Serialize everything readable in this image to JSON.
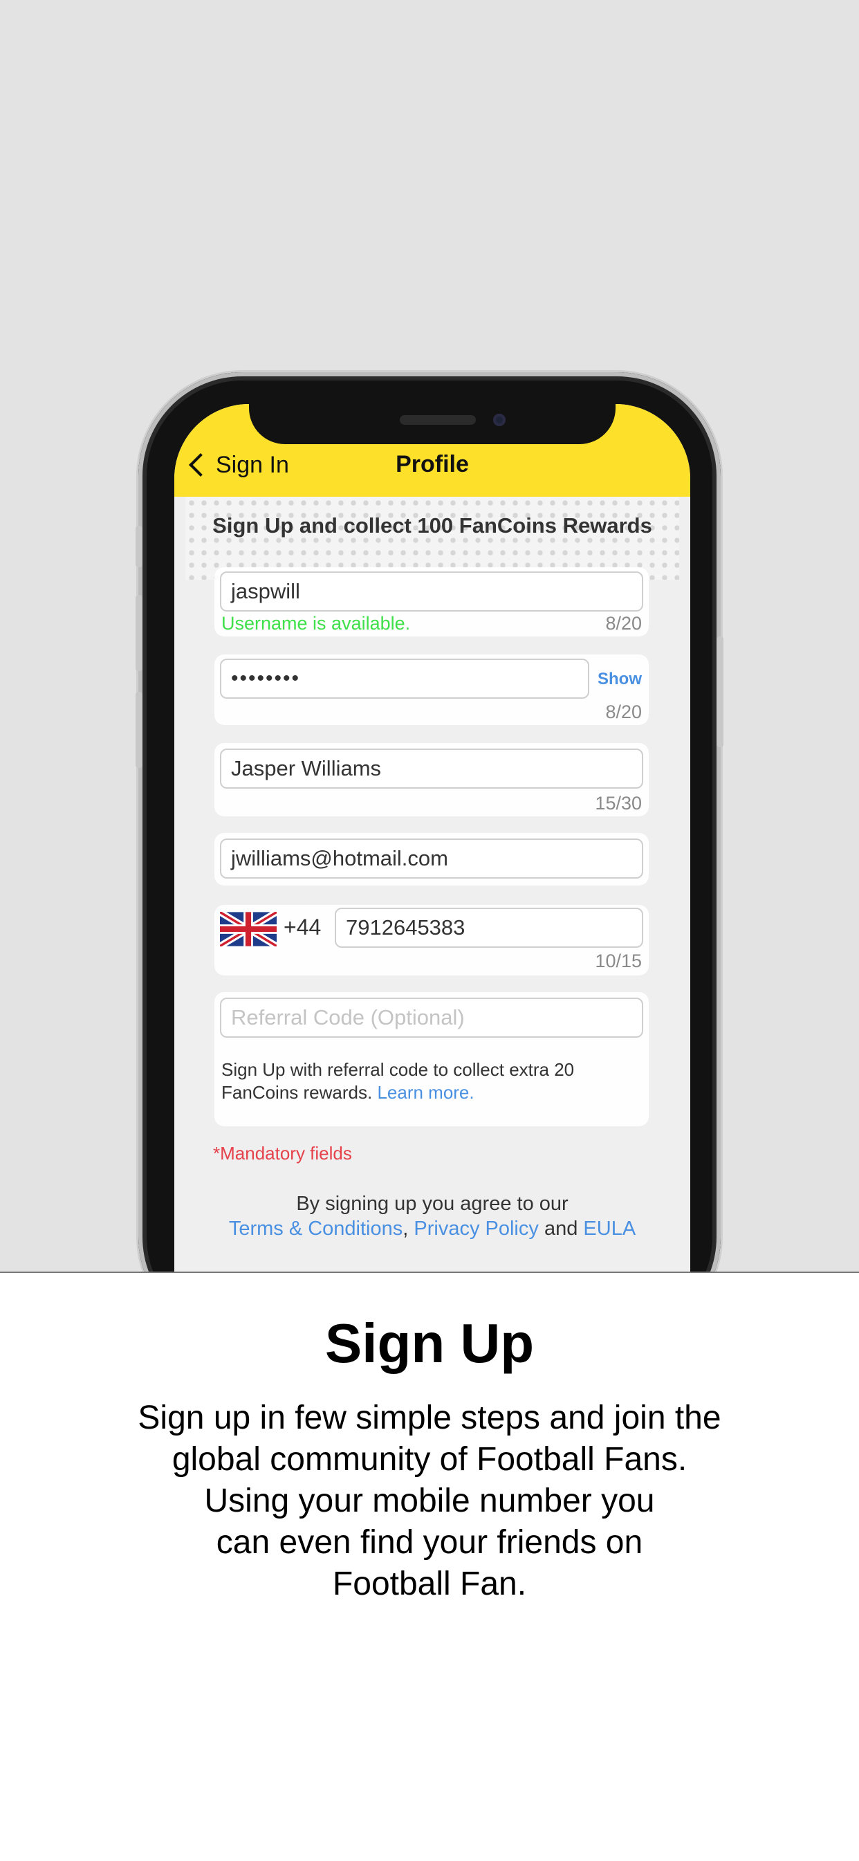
{
  "header": {
    "back_label": "Sign In",
    "title": "Profile"
  },
  "heading": "Sign Up and collect 100 FanCoins Rewards",
  "username": {
    "value": "jaspwill",
    "status": "Username is available.",
    "counter": "8/20"
  },
  "password": {
    "value": "••••••••",
    "show_label": "Show",
    "counter": "8/20"
  },
  "full_name": {
    "value": "Jasper Williams",
    "counter": "15/30"
  },
  "email": {
    "value": "jwilliams@hotmail.com"
  },
  "phone": {
    "country_code": "+44",
    "number": "7912645383",
    "counter": "10/15",
    "flag_icon": "uk-flag-icon"
  },
  "referral": {
    "placeholder": "Referral Code (Optional)",
    "note": "Sign Up with referral code to collect extra 20 FanCoins rewards.",
    "learn_more": "Learn more."
  },
  "mandatory": "*Mandatory fields",
  "agreement": {
    "intro": "By signing up you agree to our",
    "terms": "Terms & Conditions",
    "sep": ",",
    "privacy": "Privacy Policy",
    "and": "and",
    "eula": "EULA"
  },
  "panel": {
    "title": "Sign Up",
    "line1": "Sign up in few simple steps and join the",
    "line2": "global community of Football Fans.",
    "line3": "Using your mobile number you",
    "line4": "can even find your friends on",
    "line5": "Football Fan."
  },
  "colors": {
    "nav_yellow": "#fde02a",
    "link_blue": "#4a90e2",
    "success_green": "#3fe04a",
    "error_red": "#e6424b"
  }
}
